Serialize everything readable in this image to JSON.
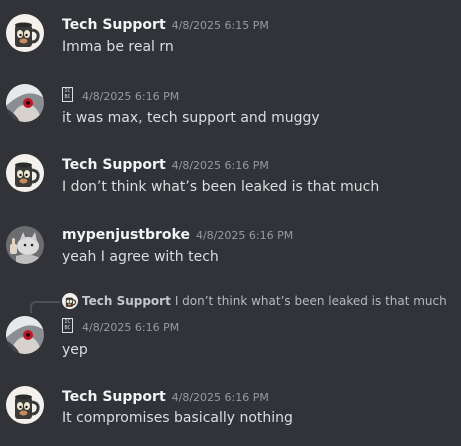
{
  "messages": [
    {
      "username": "Tech Support",
      "timestamp": "4/8/2025 6:15 PM",
      "content": "Imma be real rn"
    },
    {
      "username": "",
      "tag": "IC\nBC",
      "timestamp": "4/8/2025 6:16 PM",
      "content": "it was max, tech support and muggy"
    },
    {
      "username": "Tech Support",
      "timestamp": "4/8/2025 6:16 PM",
      "content": "I don’t think what’s been leaked is that much"
    },
    {
      "username": "mypenjustbroke",
      "timestamp": "4/8/2025 6:16 PM",
      "content": "yeah I agree with tech"
    },
    {
      "reply_to": {
        "username": "Tech Support",
        "content": "I don’t think what’s been leaked is that much"
      },
      "username": "",
      "tag": "IC\nBC",
      "timestamp": "4/8/2025 6:16 PM",
      "content": "yep"
    },
    {
      "username": "Tech Support",
      "timestamp": "4/8/2025 6:16 PM",
      "content": "It compromises basically nothing"
    }
  ],
  "icons": {
    "tech_support_avatar": "mug-face-avatar",
    "anime_avatar": "anime-character-avatar",
    "cat_avatar": "cat-thumbs-up-avatar"
  },
  "colors": {
    "background": "#313338",
    "username": "#f2f3f5",
    "text": "#dbdee1",
    "timestamp": "#949ba4"
  }
}
